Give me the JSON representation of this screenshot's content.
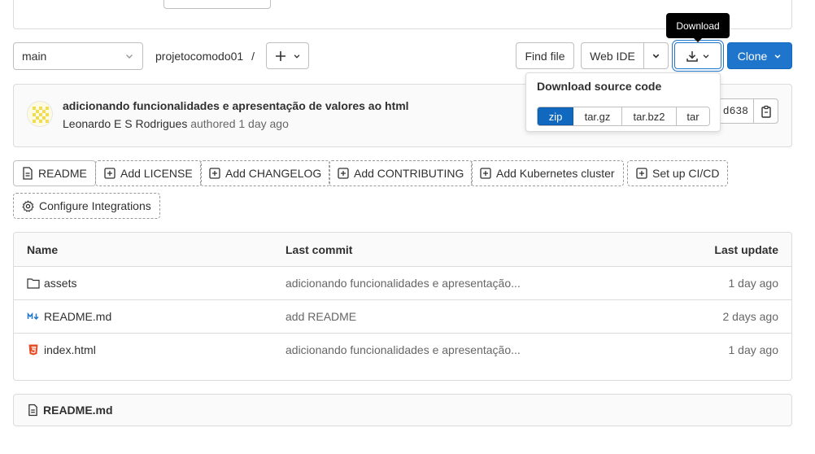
{
  "repo_bar": {
    "branch": "main",
    "breadcrumb": "projetocomodo01",
    "breadcrumb_sep": "/",
    "find_file_label": "Find file",
    "web_ide_label": "Web IDE",
    "clone_label": "Clone"
  },
  "tooltip": {
    "text": "Download"
  },
  "download_dropdown": {
    "title": "Download source code",
    "formats": [
      "zip",
      "tar.gz",
      "tar.bz2",
      "tar"
    ],
    "selected": "zip"
  },
  "last_commit": {
    "title": "adicionando funcionalidades e apresentação de valores ao html",
    "author": "Leonardo E S Rodrigues",
    "authored_text": "authored 1 day ago",
    "sha_short": "d638"
  },
  "quick_actions": [
    {
      "label": "README",
      "icon": "doc-icon"
    },
    {
      "label": "Add LICENSE",
      "icon": "plus-square-icon"
    },
    {
      "label": "Add CHANGELOG",
      "icon": "plus-square-icon"
    },
    {
      "label": "Add CONTRIBUTING",
      "icon": "plus-square-icon"
    },
    {
      "label": "Add Kubernetes cluster",
      "icon": "plus-square-icon"
    },
    {
      "label": "Set up CI/CD",
      "icon": "plus-square-icon"
    },
    {
      "label": "Configure Integrations",
      "icon": "gear-icon"
    }
  ],
  "file_table": {
    "headers": {
      "name": "Name",
      "last_commit": "Last commit",
      "last_update": "Last update"
    },
    "rows": [
      {
        "name": "assets",
        "type": "folder",
        "commit": "adicionando funcionalidades e apresentação...",
        "updated": "1 day ago"
      },
      {
        "name": "README.md",
        "type": "markdown",
        "commit": "add README",
        "updated": "2 days ago"
      },
      {
        "name": "index.html",
        "type": "html",
        "commit": "adicionando funcionalidades e apresentação...",
        "updated": "1 day ago"
      }
    ]
  },
  "readme": {
    "title": "README.md"
  },
  "colors": {
    "accent": "#1f75cb",
    "border": "#dbdbdb",
    "html_icon": "#e44d26",
    "md_icon": "#1f75cb"
  }
}
